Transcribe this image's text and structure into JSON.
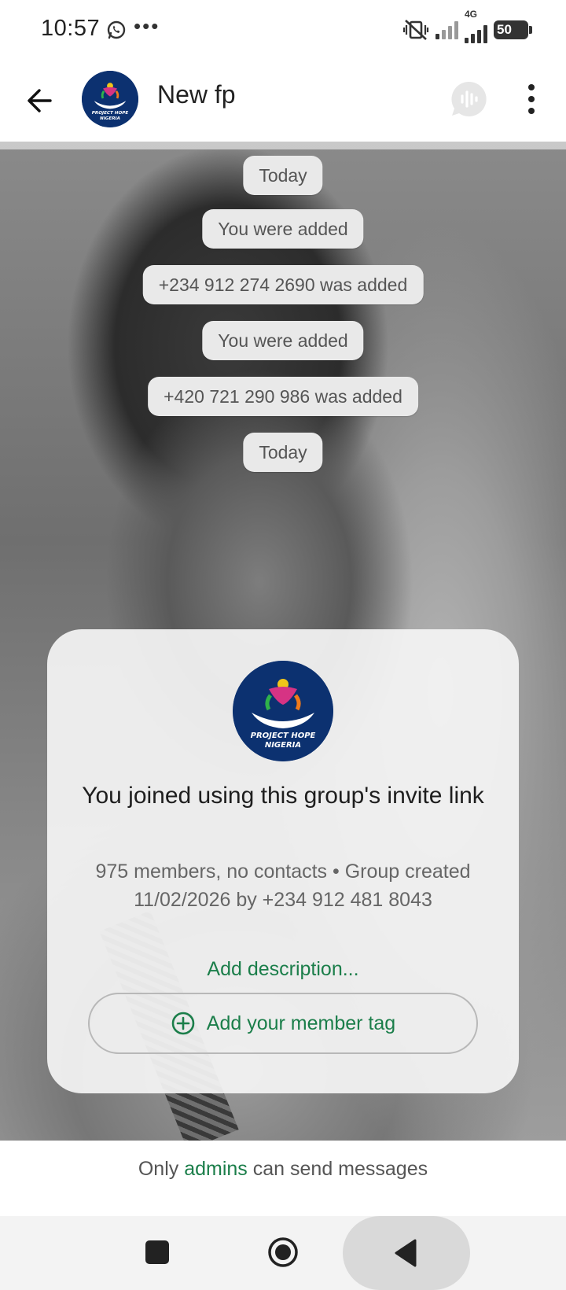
{
  "status_bar": {
    "time": "10:57",
    "network_label": "4G",
    "battery": "50"
  },
  "header": {
    "title": "New fp",
    "avatar_text_1": "PROJECT HOPE",
    "avatar_text_2": "NIGERIA"
  },
  "messages": [
    {
      "text": "Today"
    },
    {
      "text": "You were added"
    },
    {
      "text": "+234 912 274 2690 was added"
    },
    {
      "text": "You were added"
    },
    {
      "text": "+420 721 290 986 was added"
    },
    {
      "text": "Today"
    }
  ],
  "group_card": {
    "title": "You joined using this group's invite link",
    "meta": "975 members, no contacts  •  Group created 11/02/2026 by +234 912 481 8043",
    "add_description": "Add description...",
    "member_tag_label": "Add your member tag"
  },
  "footer": {
    "prefix": "Only",
    "link": "admins",
    "suffix": "can send messages"
  },
  "colors": {
    "accent": "#1b7e4a",
    "logo_bg": "#0c3170"
  }
}
